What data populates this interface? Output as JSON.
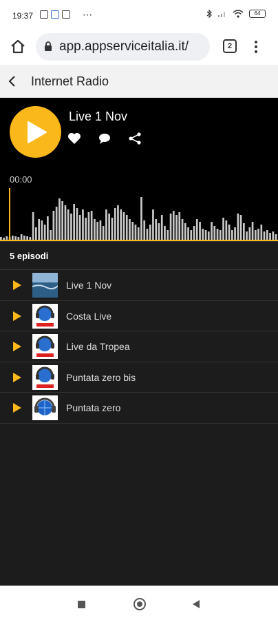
{
  "status": {
    "time": "19:37",
    "dots": "⋯",
    "battery": "64"
  },
  "browser": {
    "url": "app.appserviceitalia.it/",
    "tab_count": "2"
  },
  "app": {
    "title": "Internet Radio"
  },
  "player": {
    "title": "Live 1 Nov",
    "time": "00:00",
    "progress": 0.0,
    "accent": "#fbb81b"
  },
  "episodes": {
    "count_label": "5 episodi",
    "items": [
      {
        "label": "Live 1 Nov",
        "thumb": "sea-photo"
      },
      {
        "label": "Costa Live",
        "thumb": "appradio-logo"
      },
      {
        "label": "Live da Tropea",
        "thumb": "appradio-logo"
      },
      {
        "label": "Puntata zero bis",
        "thumb": "appradio-logo"
      },
      {
        "label": "Puntata zero",
        "thumb": "headphones-globe-logo"
      }
    ]
  }
}
